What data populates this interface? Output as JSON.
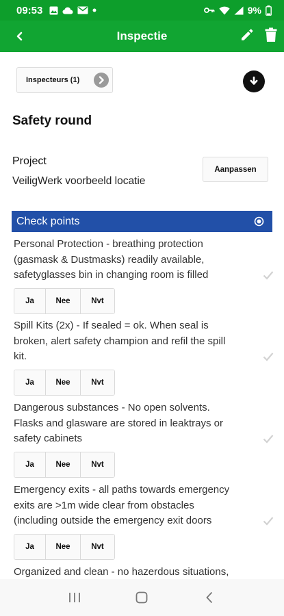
{
  "status_bar": {
    "time": "09:53",
    "battery": "9%"
  },
  "app_bar": {
    "title": "Inspectie",
    "icons": [
      "back-arrow-icon",
      "pencil-icon",
      "trash-icon"
    ]
  },
  "inspectors_button": "Inspecteurs (1)",
  "title": "Safety round",
  "project": {
    "label": "Project",
    "value": "VeiligWerk voorbeeld locatie",
    "adjust_label": "Aanpassen"
  },
  "section": {
    "title": "Check points"
  },
  "answer_options": [
    "Ja",
    "Nee",
    "Nvt"
  ],
  "check_points": [
    {
      "lines": [
        "Personal Protection - breathing protection",
        "(gasmask & Dustmasks) readily available,",
        "safetyglasses bin in changing room is filled"
      ]
    },
    {
      "lines": [
        "Spill Kits (2x) - If sealed = ok. When seal is",
        "broken, alert safety champion and refil the spill",
        "kit."
      ]
    },
    {
      "lines": [
        "Dangerous substances - No open solvents.",
        "Flasks and glasware are stored in leaktrays or",
        "safety cabinets"
      ]
    },
    {
      "lines": [
        "Emergency exits - all paths towards emergency",
        "exits are >1m wide clear from obstacles",
        "(including outside the emergency exit doors"
      ]
    },
    {
      "lines": [
        "Organized and clean - no hazerdous situations,"
      ]
    }
  ],
  "colors": {
    "status_bar": "#0d9e2b",
    "app_bar": "#11a532",
    "section_header": "#2250a8"
  }
}
